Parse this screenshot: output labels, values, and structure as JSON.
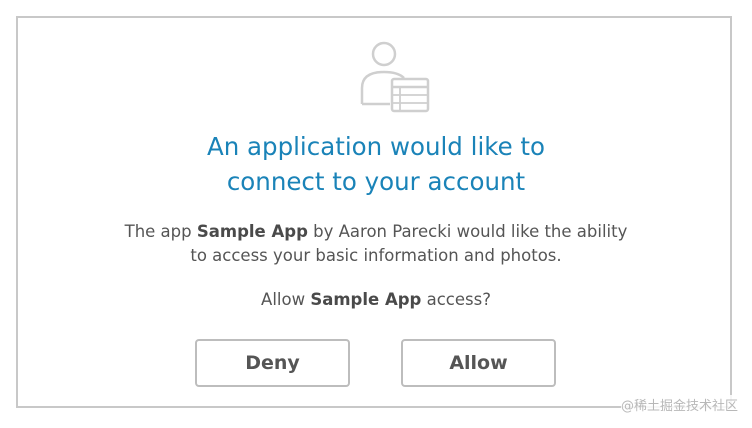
{
  "dialog": {
    "icon": "user-with-window-icon",
    "heading_line1": "An application would like to",
    "heading_line2": "connect to your account",
    "desc_prefix": "The app ",
    "app_name": "Sample App",
    "desc_middle": " by Aaron Parecki would like the ability",
    "desc_line2": "to access your basic information and photos.",
    "question_prefix": "Allow ",
    "question_suffix": " access?",
    "deny_label": "Deny",
    "allow_label": "Allow"
  },
  "watermark": "@稀土掘金技术社区",
  "colors": {
    "heading": "#1a83b8",
    "text": "#555555",
    "border": "#c8c8c8",
    "icon": "#cfcfcf"
  }
}
